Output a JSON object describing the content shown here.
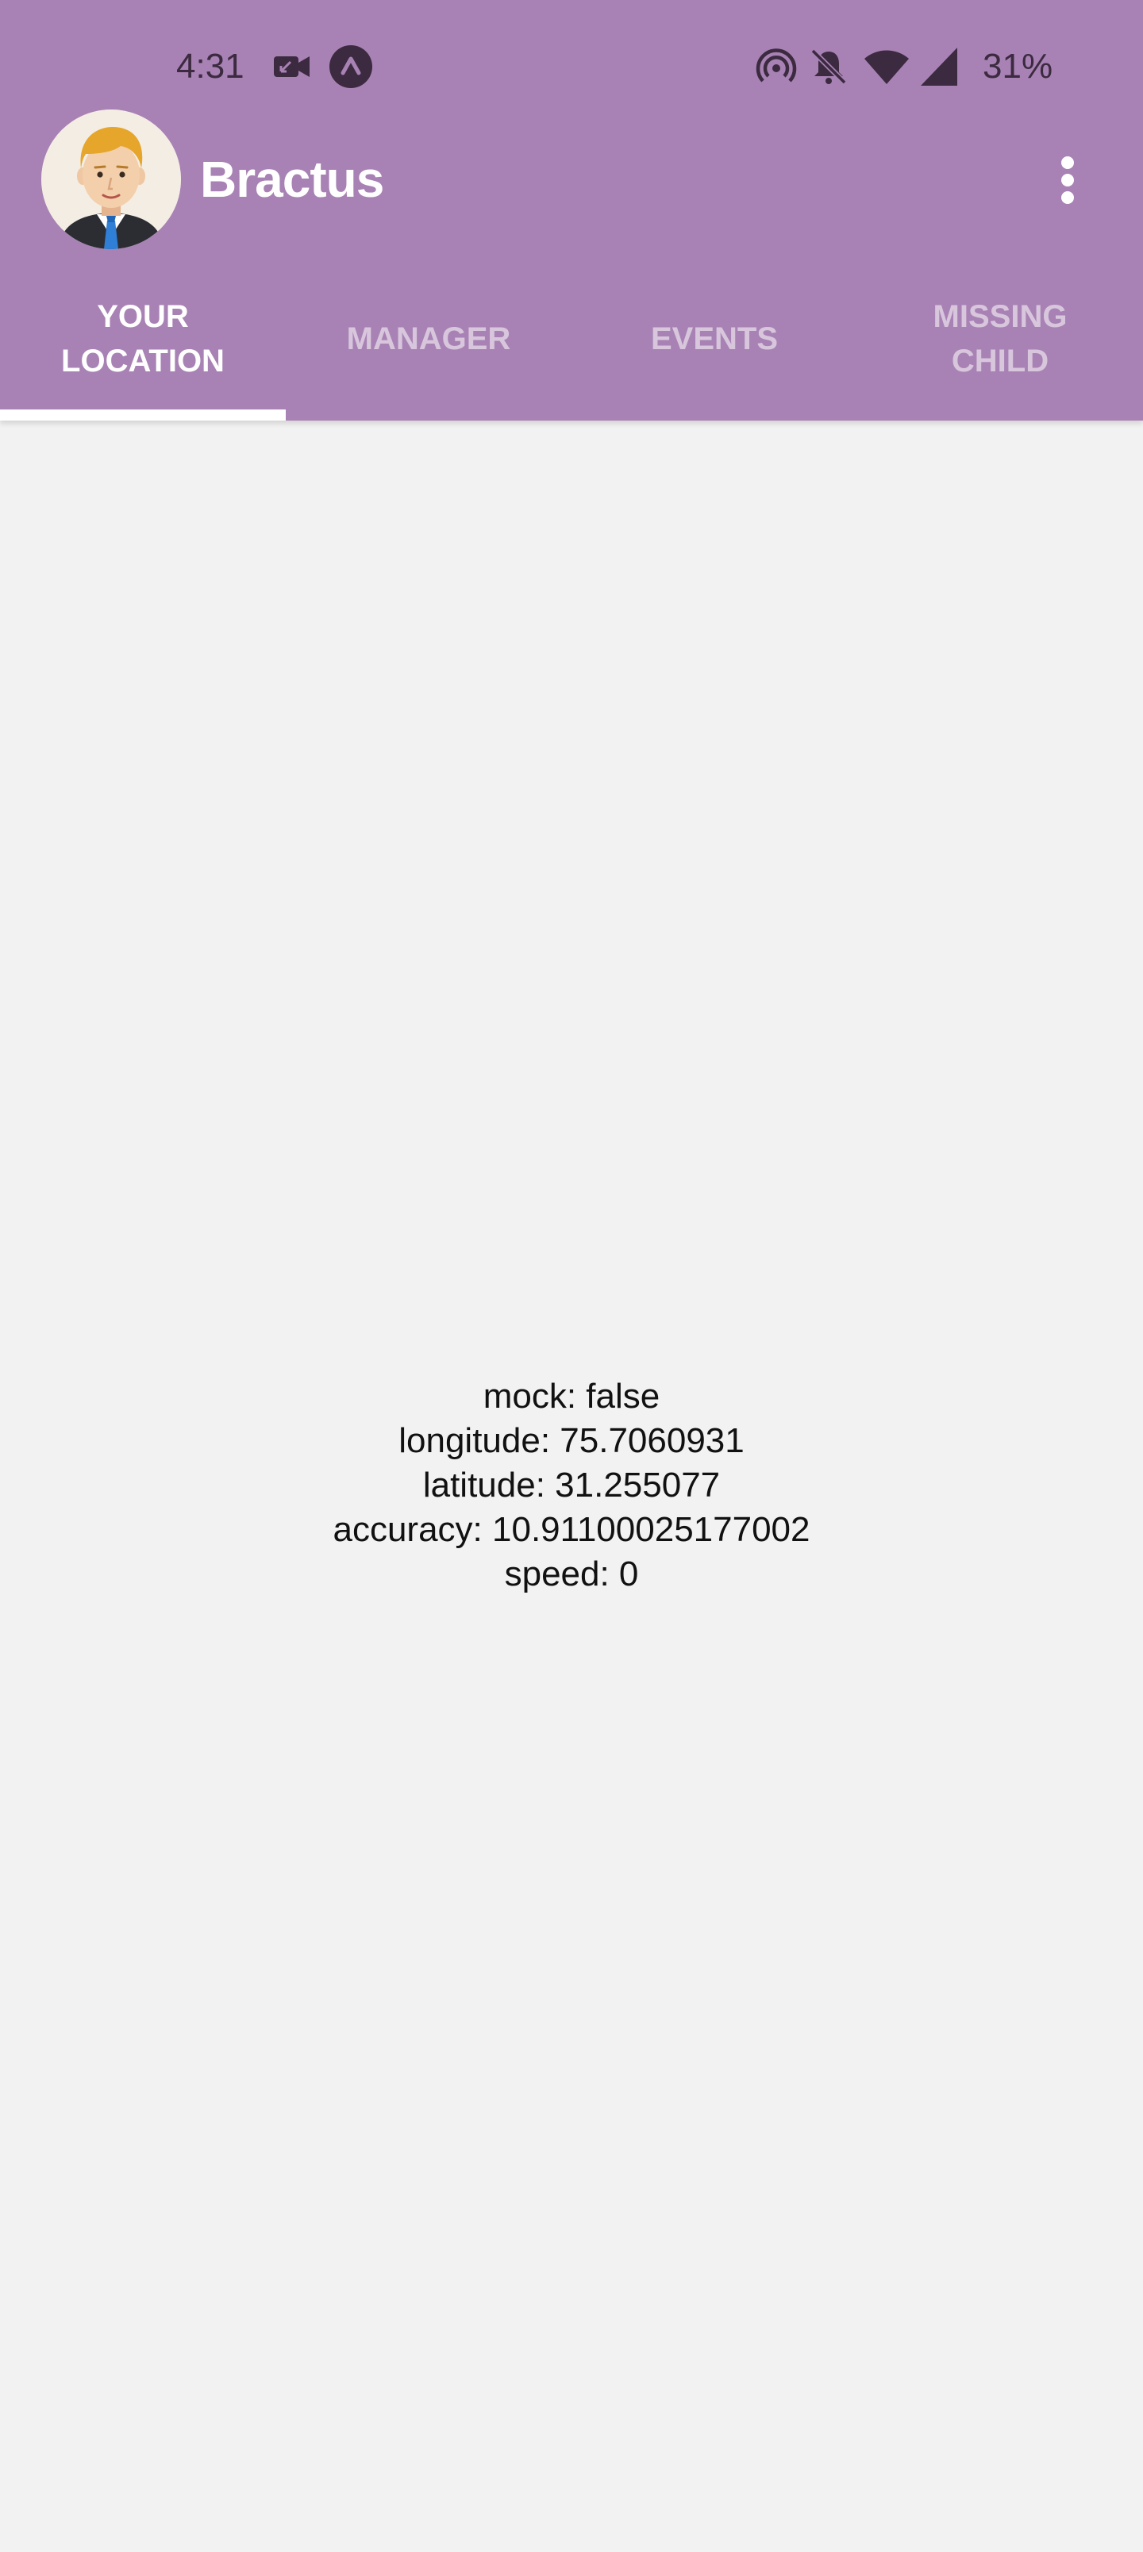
{
  "status_bar": {
    "time": "4:31",
    "battery": "31%",
    "icons": [
      "video-call-icon",
      "app-notification-icon",
      "hotspot-icon",
      "bell-off-icon",
      "wifi-icon",
      "signal-icon"
    ]
  },
  "header": {
    "title": "Bractus",
    "avatar": "user-avatar",
    "menu_icon": "more-vert-icon"
  },
  "tabs": [
    {
      "label": "YOUR\nLOCATION",
      "active": true
    },
    {
      "label": "MANAGER",
      "active": false
    },
    {
      "label": "EVENTS",
      "active": false
    },
    {
      "label": "MISSING\nCHILD",
      "active": false
    }
  ],
  "location": {
    "mock": "mock: false",
    "longitude": "longitude: 75.7060931",
    "latitude": "latitude: 31.255077",
    "accuracy": "accuracy: 10.91100025177002",
    "speed": "speed: 0"
  },
  "colors": {
    "appbar": "#a882b4",
    "background": "#f2f2f2",
    "status_icons": "#3b2a40"
  }
}
